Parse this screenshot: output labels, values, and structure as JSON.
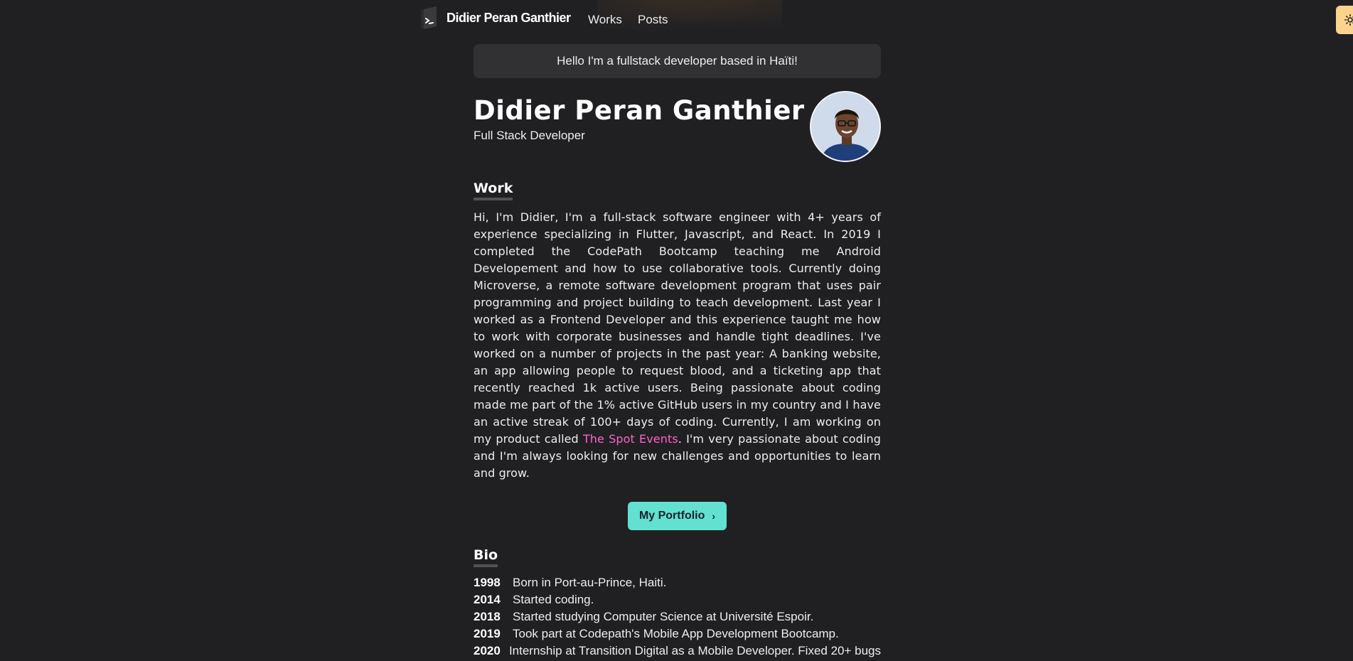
{
  "nav": {
    "logo_text": "Didier Peran Ganthier",
    "links": [
      {
        "label": "Works"
      },
      {
        "label": "Posts"
      }
    ],
    "theme_toggle_icon": "sun-icon"
  },
  "hero": {
    "banner": "Hello I'm a fullstack developer based in Haïti!",
    "name": "Didier Peran Ganthier",
    "role": "Full Stack Developer"
  },
  "work": {
    "heading": "Work",
    "paragraph_before": "Hi, I'm Didier, I'm a full-stack software engineer with 4+ years of experience specializing in Flutter, Javascript, and React. In 2019 I completed the CodePath Bootcamp teaching me Android Developement and how to use collaborative tools. Currently doing Microverse, a remote software development program that uses pair programming and project building to teach development. Last year I worked as a Frontend Developer and this experience taught me how to work with corporate businesses and handle tight deadlines. I've worked on a number of projects in the past year: A banking website, an app allowing people to request blood, and a ticketing app that recently reached 1k active users. Being passionate about coding made me part of the 1% active GitHub users in my country and I have an active streak of 100+ days of coding. Currently, I am working on my product called ",
    "link_text": "The Spot Events",
    "paragraph_after": ". I'm very passionate about coding and I'm always looking for new challenges and opportunities to learn and grow.",
    "button_label": "My Portfolio"
  },
  "bio": {
    "heading": "Bio",
    "entries": [
      {
        "year": "1998",
        "text": "Born in Port-au-Prince, Haiti."
      },
      {
        "year": "2014",
        "text": "Started coding."
      },
      {
        "year": "2018",
        "text": "Started studying Computer Science at Université Espoir."
      },
      {
        "year": "2019",
        "text": "Took part at Codepath's Mobile App Development Bootcamp."
      },
      {
        "year": "2020",
        "text": "Internship at Transition Digital as a Mobile Developer. Fixed 20+ bugs"
      }
    ]
  },
  "colors": {
    "background": "#202023",
    "accent_teal": "#62e0d0",
    "accent_pink": "#ff63c3",
    "toggle_bg": "#fbd38d"
  }
}
